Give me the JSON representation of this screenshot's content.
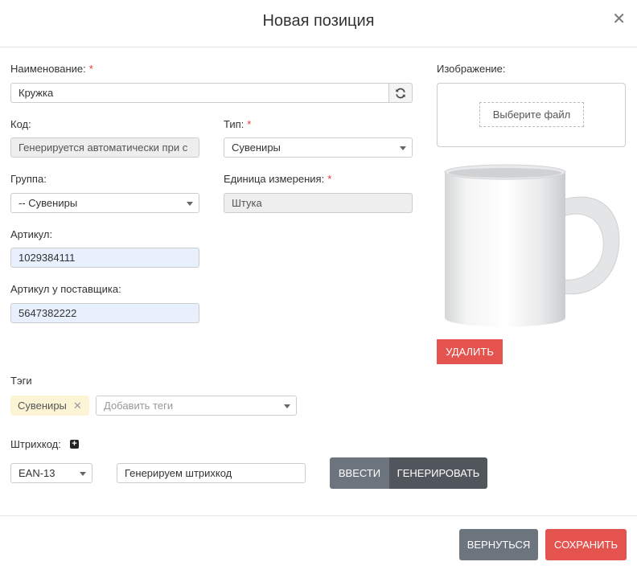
{
  "modal": {
    "title": "Новая позиция"
  },
  "form": {
    "name": {
      "label": "Наименование:",
      "value": "Кружка"
    },
    "code": {
      "label": "Код:",
      "value": "Генерируется автоматически при с"
    },
    "type": {
      "label": "Тип:",
      "value": "Сувениры"
    },
    "group": {
      "label": "Группа:",
      "value": "-- Сувениры"
    },
    "unit": {
      "label": "Единица измерения:",
      "value": "Штука"
    },
    "article": {
      "label": "Артикул:",
      "value": "1029384111"
    },
    "supplier_article": {
      "label": "Артикул у поставщика:",
      "value": "5647382222"
    },
    "tags": {
      "label": "Тэги",
      "items": [
        "Сувениры"
      ],
      "placeholder": "Добавить теги"
    },
    "barcode": {
      "label": "Штрихкод:",
      "type": "EAN-13",
      "value": "Генерируем штрихкод",
      "enter_label": "ВВЕСТИ",
      "generate_label": "ГЕНЕРИРОВАТЬ"
    },
    "required_mark": "*"
  },
  "image": {
    "label": "Изображение:",
    "choose_file": "Выберите файл",
    "delete_label": "УДАЛИТЬ"
  },
  "footer": {
    "back_label": "ВЕРНУТЬСЯ",
    "save_label": "СОХРАНИТЬ"
  },
  "colors": {
    "accent_red": "#e4534e",
    "gray_button": "#6c757d",
    "dark_button": "#51565c",
    "autofill_blue": "#e8f0fe"
  }
}
